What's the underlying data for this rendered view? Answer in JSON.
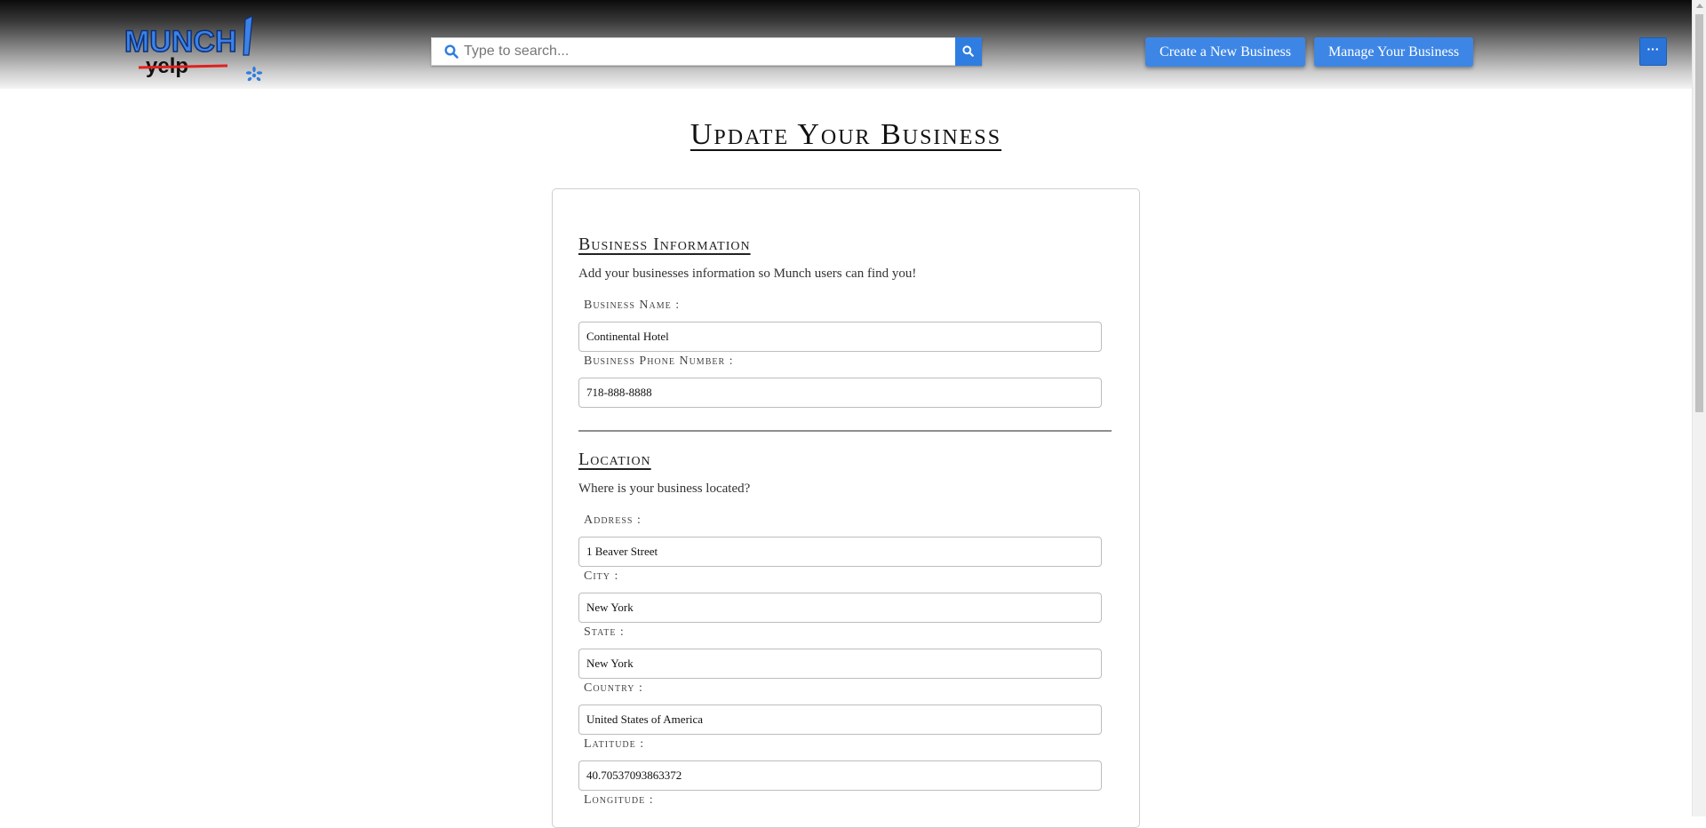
{
  "header": {
    "logo": {
      "primary_text": "MUNCH",
      "secondary_text": "yelp"
    },
    "search": {
      "placeholder": "Type to search...",
      "value": ""
    },
    "buttons": {
      "create_label": "Create a New Business",
      "manage_label": "Manage Your Business",
      "more_label": "···"
    }
  },
  "page": {
    "title": "Update Your Business"
  },
  "business_info": {
    "heading": "Business Information",
    "description": "Add your businesses information so Munch users can find you!",
    "fields": {
      "name": {
        "label": "Business Name :",
        "value": "Continental Hotel"
      },
      "phone": {
        "label": "Business Phone Number :",
        "value": "718-888-8888"
      }
    }
  },
  "location": {
    "heading": "Location",
    "description": "Where is your business located?",
    "fields": {
      "address": {
        "label": "Address :",
        "value": "1 Beaver Street"
      },
      "city": {
        "label": "City :",
        "value": "New York"
      },
      "state": {
        "label": "State :",
        "value": "New York"
      },
      "country": {
        "label": "Country :",
        "value": "United States of America"
      },
      "latitude": {
        "label": "Latitude :",
        "value": "40.70537093863372"
      },
      "longitude": {
        "label": "Longitude :",
        "value": ""
      }
    }
  },
  "colors": {
    "accent": "#3d86e6",
    "logo_blue": "#2f7de1",
    "logo_strike": "#e02020"
  },
  "icons": {
    "search": "search-icon",
    "logo_burst": "asterisk-burst-icon"
  }
}
